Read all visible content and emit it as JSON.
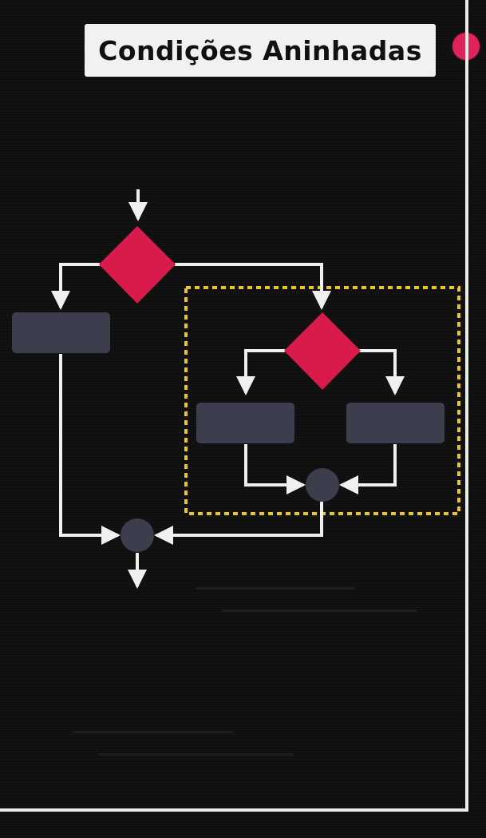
{
  "title": "Condições Aninhadas",
  "colors": {
    "background": "#0f0f0f",
    "decision": "#d81b4a",
    "process": "#3c3e4d",
    "merge": "#3c3e4d",
    "arrow": "#f0f0f0",
    "highlight": "#e8c727",
    "accent_dot": "#e0245a",
    "frame": "#e8ede6",
    "title_background": "#f1f1ef"
  },
  "icons": {
    "accent_dot": "record-dot-icon"
  },
  "diagram": {
    "nodes": [
      {
        "id": "decision-outer",
        "type": "decision"
      },
      {
        "id": "process-left",
        "type": "process"
      },
      {
        "id": "decision-inner",
        "type": "decision"
      },
      {
        "id": "process-inner-left",
        "type": "process"
      },
      {
        "id": "process-inner-right",
        "type": "process"
      },
      {
        "id": "merge-inner",
        "type": "merge"
      },
      {
        "id": "merge-outer",
        "type": "merge"
      }
    ],
    "edges": [
      [
        "start",
        "decision-outer"
      ],
      [
        "decision-outer",
        "process-left"
      ],
      [
        "decision-outer",
        "decision-inner"
      ],
      [
        "decision-inner",
        "process-inner-left"
      ],
      [
        "decision-inner",
        "process-inner-right"
      ],
      [
        "process-inner-left",
        "merge-inner"
      ],
      [
        "process-inner-right",
        "merge-inner"
      ],
      [
        "process-left",
        "merge-outer"
      ],
      [
        "merge-inner",
        "merge-outer"
      ],
      [
        "merge-outer",
        "end"
      ]
    ],
    "highlight_group": [
      "decision-inner",
      "process-inner-left",
      "process-inner-right",
      "merge-inner"
    ]
  }
}
